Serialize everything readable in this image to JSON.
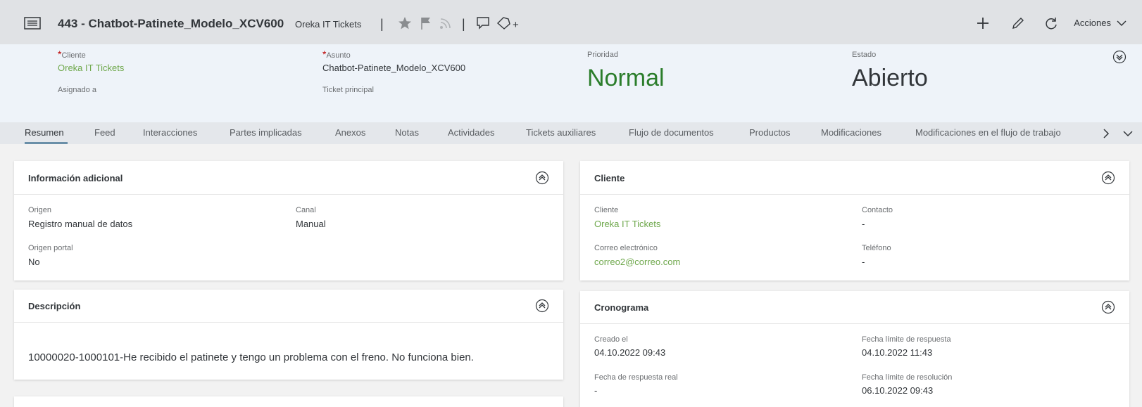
{
  "shell": {
    "title": "443 - Chatbot-Patinete_Modelo_XCV600",
    "subtitle": "Oreka IT Tickets",
    "sep1": "|",
    "sep2": "|",
    "plus_small": "+",
    "actions_label": "Acciones"
  },
  "header": {
    "cliente_label": "Cliente",
    "cliente_value": "Oreka IT Tickets",
    "asignado_label": "Asignado a",
    "asunto_label": "Asunto",
    "asunto_value": "Chatbot-Patinete_Modelo_XCV600",
    "ticket_principal_label": "Ticket principal",
    "prioridad_label": "Prioridad",
    "prioridad_value": "Normal",
    "estado_label": "Estado",
    "estado_value": "Abierto",
    "required_mark": "*"
  },
  "tabs": [
    "Resumen",
    "Feed",
    "Interacciones",
    "Partes implicadas",
    "Anexos",
    "Notas",
    "Actividades",
    "Tickets auxiliares",
    "Flujo de documentos",
    "Productos",
    "Modificaciones",
    "Modificaciones en el flujo de trabajo"
  ],
  "info_card": {
    "title": "Información adicional",
    "origen_label": "Origen",
    "origen_value": "Registro manual de datos",
    "canal_label": "Canal",
    "canal_value": "Manual",
    "origen_portal_label": "Origen portal",
    "origen_portal_value": "No"
  },
  "desc_card": {
    "title": "Descripción",
    "text": "10000020-1000101-He recibido el patinete y tengo un problema con el freno. No funciona bien."
  },
  "cliente_card": {
    "title": "Cliente",
    "cliente_label": "Cliente",
    "cliente_value": "Oreka IT Tickets",
    "contacto_label": "Contacto",
    "contacto_value": "-",
    "correo_label": "Correo electrónico",
    "correo_value": "correo2@correo.com",
    "telefono_label": "Teléfono",
    "telefono_value": "-"
  },
  "crono_card": {
    "title": "Cronograma",
    "creado_label": "Creado el",
    "creado_value": "04.10.2022 09:43",
    "limite_resp_label": "Fecha límite de respuesta",
    "limite_resp_value": "04.10.2022 11:43",
    "resp_real_label": "Fecha de respuesta real",
    "resp_real_value": "-",
    "limite_resol_label": "Fecha límite de resolución",
    "limite_resol_value": "06.10.2022 09:43"
  },
  "colors": {
    "link_green": "#6fa84c",
    "priority_green": "#2b7d2b",
    "shell_bg": "#e0e2e5",
    "header_bg": "#eef3f9"
  }
}
